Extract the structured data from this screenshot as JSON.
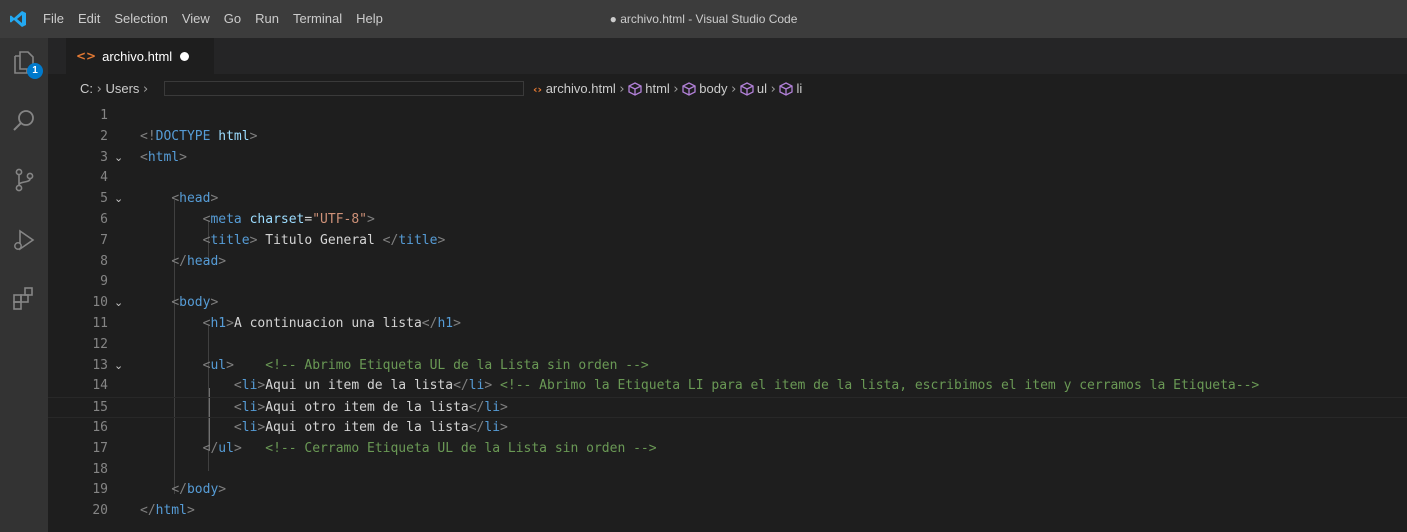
{
  "titlebar": {
    "menu": [
      "File",
      "Edit",
      "Selection",
      "View",
      "Go",
      "Run",
      "Terminal",
      "Help"
    ],
    "window_title": "● archivo.html - Visual Studio Code"
  },
  "activitybar": {
    "items": [
      "explorer-icon",
      "search-icon",
      "source-control-icon",
      "run-debug-icon",
      "extensions-icon"
    ],
    "explorer_badge": "1"
  },
  "tab": {
    "icon": "<>",
    "label": "archivo.html"
  },
  "breadcrumb": {
    "drive": "C:",
    "users": "Users",
    "file": "archivo.html",
    "symbols": [
      "html",
      "body",
      "ul",
      "li"
    ]
  },
  "editor": {
    "current_line": 15,
    "lines": [
      {
        "n": "1",
        "fold": "",
        "tokens": []
      },
      {
        "n": "2",
        "fold": "",
        "tokens": [
          {
            "t": "<!",
            "c": "bracket"
          },
          {
            "t": "DOCTYPE",
            "c": "doctype"
          },
          {
            "t": " html",
            "c": "attr"
          },
          {
            "t": ">",
            "c": "bracket"
          }
        ]
      },
      {
        "n": "3",
        "fold": "⌄",
        "tokens": [
          {
            "t": "<",
            "c": "bracket"
          },
          {
            "t": "html",
            "c": "tag"
          },
          {
            "t": ">",
            "c": "bracket"
          }
        ]
      },
      {
        "n": "4",
        "fold": "",
        "tokens": []
      },
      {
        "n": "5",
        "fold": "⌄",
        "tokens": [
          {
            "t": "    ",
            "c": "text"
          },
          {
            "t": "<",
            "c": "bracket"
          },
          {
            "t": "head",
            "c": "tag"
          },
          {
            "t": ">",
            "c": "bracket"
          }
        ]
      },
      {
        "n": "6",
        "fold": "",
        "tokens": [
          {
            "t": "        ",
            "c": "text"
          },
          {
            "t": "<",
            "c": "bracket"
          },
          {
            "t": "meta",
            "c": "tag"
          },
          {
            "t": " charset",
            "c": "attr"
          },
          {
            "t": "=",
            "c": "text"
          },
          {
            "t": "\"UTF-8\"",
            "c": "str"
          },
          {
            "t": ">",
            "c": "bracket"
          }
        ]
      },
      {
        "n": "7",
        "fold": "",
        "tokens": [
          {
            "t": "        ",
            "c": "text"
          },
          {
            "t": "<",
            "c": "bracket"
          },
          {
            "t": "title",
            "c": "tag"
          },
          {
            "t": ">",
            "c": "bracket"
          },
          {
            "t": " Titulo General ",
            "c": "text"
          },
          {
            "t": "</",
            "c": "bracket"
          },
          {
            "t": "title",
            "c": "tag"
          },
          {
            "t": ">",
            "c": "bracket"
          }
        ]
      },
      {
        "n": "8",
        "fold": "",
        "tokens": [
          {
            "t": "    ",
            "c": "text"
          },
          {
            "t": "</",
            "c": "bracket"
          },
          {
            "t": "head",
            "c": "tag"
          },
          {
            "t": ">",
            "c": "bracket"
          }
        ]
      },
      {
        "n": "9",
        "fold": "",
        "tokens": []
      },
      {
        "n": "10",
        "fold": "⌄",
        "tokens": [
          {
            "t": "    ",
            "c": "text"
          },
          {
            "t": "<",
            "c": "bracket"
          },
          {
            "t": "body",
            "c": "tag"
          },
          {
            "t": ">",
            "c": "bracket"
          }
        ]
      },
      {
        "n": "11",
        "fold": "",
        "tokens": [
          {
            "t": "        ",
            "c": "text"
          },
          {
            "t": "<",
            "c": "bracket"
          },
          {
            "t": "h1",
            "c": "tag"
          },
          {
            "t": ">",
            "c": "bracket"
          },
          {
            "t": "A continuacion una lista",
            "c": "text"
          },
          {
            "t": "</",
            "c": "bracket"
          },
          {
            "t": "h1",
            "c": "tag"
          },
          {
            "t": ">",
            "c": "bracket"
          }
        ]
      },
      {
        "n": "12",
        "fold": "",
        "tokens": []
      },
      {
        "n": "13",
        "fold": "⌄",
        "tokens": [
          {
            "t": "        ",
            "c": "text"
          },
          {
            "t": "<",
            "c": "bracket"
          },
          {
            "t": "ul",
            "c": "tag"
          },
          {
            "t": ">",
            "c": "bracket"
          },
          {
            "t": "    ",
            "c": "text"
          },
          {
            "t": "<!-- Abrimo Etiqueta UL de la Lista sin orden -->",
            "c": "comment"
          }
        ]
      },
      {
        "n": "14",
        "fold": "",
        "tokens": [
          {
            "t": "            ",
            "c": "text"
          },
          {
            "t": "<",
            "c": "bracket"
          },
          {
            "t": "li",
            "c": "tag"
          },
          {
            "t": ">",
            "c": "bracket"
          },
          {
            "t": "Aqui un item de la lista",
            "c": "text"
          },
          {
            "t": "</",
            "c": "bracket"
          },
          {
            "t": "li",
            "c": "tag"
          },
          {
            "t": ">",
            "c": "bracket"
          },
          {
            "t": " ",
            "c": "text"
          },
          {
            "t": "<!-- Abrimo la Etiqueta LI para el item de la lista, escribimos el item y cerramos la Etiqueta-->",
            "c": "comment"
          }
        ]
      },
      {
        "n": "15",
        "fold": "",
        "tokens": [
          {
            "t": "            ",
            "c": "text"
          },
          {
            "t": "<",
            "c": "bracket"
          },
          {
            "t": "li",
            "c": "tag"
          },
          {
            "t": ">",
            "c": "bracket"
          },
          {
            "t": "Aqui otro item de la lista",
            "c": "text"
          },
          {
            "t": "</",
            "c": "bracket"
          },
          {
            "t": "li",
            "c": "tag"
          },
          {
            "t": ">",
            "c": "bracket"
          }
        ]
      },
      {
        "n": "16",
        "fold": "",
        "tokens": [
          {
            "t": "            ",
            "c": "text"
          },
          {
            "t": "<",
            "c": "bracket"
          },
          {
            "t": "li",
            "c": "tag"
          },
          {
            "t": ">",
            "c": "bracket"
          },
          {
            "t": "Aqui otro item de la lista",
            "c": "text"
          },
          {
            "t": "</",
            "c": "bracket"
          },
          {
            "t": "li",
            "c": "tag"
          },
          {
            "t": ">",
            "c": "bracket"
          }
        ]
      },
      {
        "n": "17",
        "fold": "",
        "tokens": [
          {
            "t": "        ",
            "c": "text"
          },
          {
            "t": "</",
            "c": "bracket"
          },
          {
            "t": "ul",
            "c": "tag"
          },
          {
            "t": ">",
            "c": "bracket"
          },
          {
            "t": "   ",
            "c": "text"
          },
          {
            "t": "<!-- Cerramo Etiqueta UL de la Lista sin orden -->",
            "c": "comment"
          }
        ]
      },
      {
        "n": "18",
        "fold": "",
        "tokens": []
      },
      {
        "n": "19",
        "fold": "",
        "tokens": [
          {
            "t": "    ",
            "c": "text"
          },
          {
            "t": "</",
            "c": "bracket"
          },
          {
            "t": "body",
            "c": "tag"
          },
          {
            "t": ">",
            "c": "bracket"
          }
        ]
      },
      {
        "n": "20",
        "fold": "",
        "tokens": [
          {
            "t": "</",
            "c": "bracket"
          },
          {
            "t": "html",
            "c": "tag"
          },
          {
            "t": ">",
            "c": "bracket"
          }
        ]
      }
    ]
  },
  "colors": {
    "titlebar": "#3c3c3c",
    "activitybar": "#333333",
    "editor": "#1e1e1e",
    "accent": "#007acc",
    "html_icon": "#e37933"
  }
}
